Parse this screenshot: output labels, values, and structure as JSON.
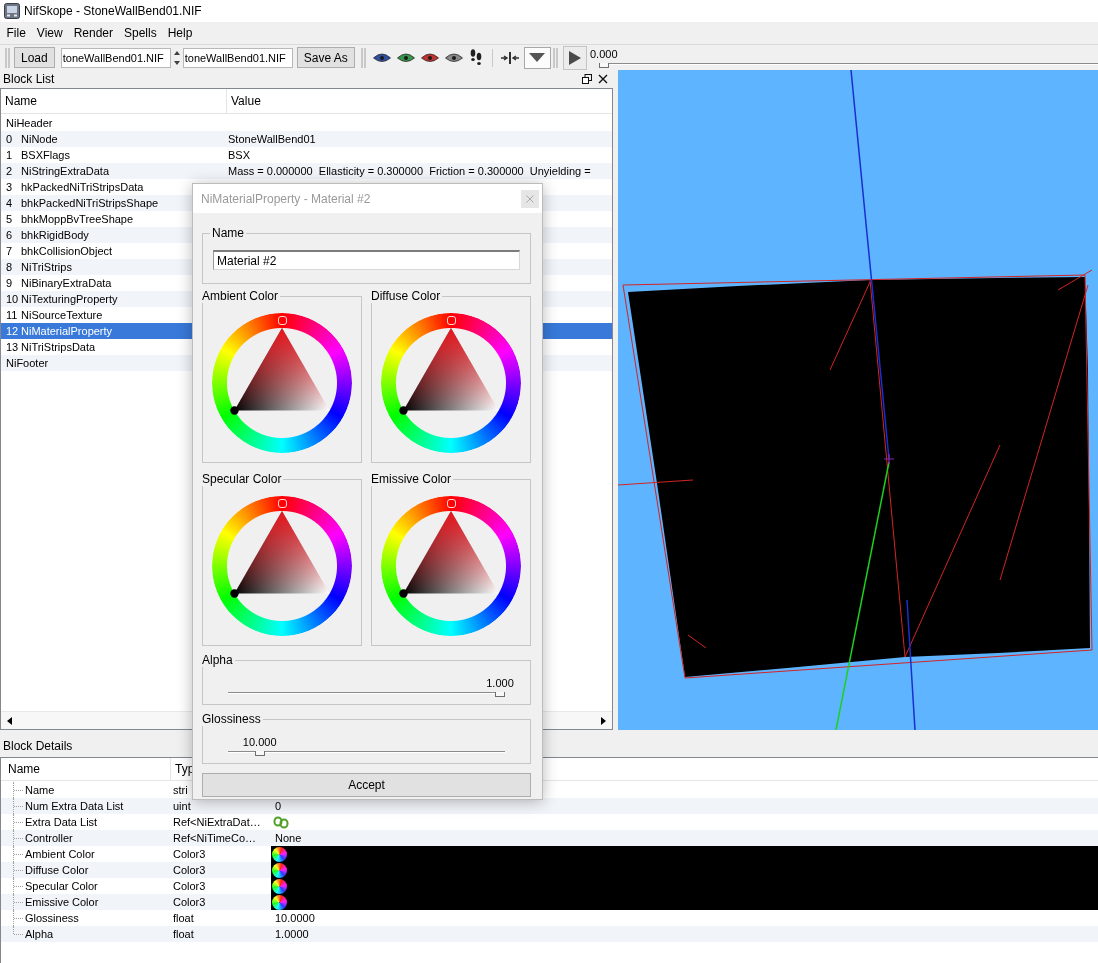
{
  "window": {
    "title": "NifSkope - StoneWallBend01.NIF"
  },
  "menu": [
    "File",
    "View",
    "Render",
    "Spells",
    "Help"
  ],
  "toolbar": {
    "load_button": "Load",
    "file_fields": [
      "toneWallBend01.NIF",
      "toneWallBend01.NIF"
    ],
    "save_button": "Save As",
    "view_buttons": [
      {
        "color": "#2f4fa3"
      },
      {
        "color": "#35984a"
      },
      {
        "color": "#c23232"
      },
      {
        "color": "#8a8a8a"
      }
    ],
    "dropdown_button": {
      "checked": true
    },
    "time_slider": {
      "reading": "0.000",
      "level": 0
    }
  },
  "block_list": {
    "title": "Block List",
    "columns": [
      "Name",
      "Value"
    ],
    "rows": [
      {
        "name": "NiHeader",
        "selected": false
      },
      {
        "index": "0",
        "name": "NiNode",
        "value": "StoneWallBend01",
        "selected": false
      },
      {
        "index": "1",
        "name": "BSXFlags",
        "value": "BSX",
        "selected": false
      },
      {
        "index": "2",
        "name": "NiStringExtraData",
        "value": "Mass = 0.000000  Ellasticity = 0.300000  Friction = 0.300000  Unyielding =",
        "selected": false
      },
      {
        "index": "3",
        "name": "hkPackedNiTriStripsData",
        "selected": false
      },
      {
        "index": "4",
        "name": "bhkPackedNiTriStripsShape",
        "selected": false
      },
      {
        "index": "5",
        "name": "bhkMoppBvTreeShape",
        "selected": false
      },
      {
        "index": "6",
        "name": "bhkRigidBody",
        "selected": false
      },
      {
        "index": "7",
        "name": "bhkCollisionObject",
        "selected": false
      },
      {
        "index": "8",
        "name": "NiTriStrips",
        "selected": false
      },
      {
        "index": "9",
        "name": "NiBinaryExtraData",
        "selected": false
      },
      {
        "index": "10",
        "name": "NiTexturingProperty",
        "selected": false
      },
      {
        "index": "11",
        "name": "NiSourceTexture",
        "selected": false
      },
      {
        "index": "12",
        "name": "NiMaterialProperty",
        "selected": true
      },
      {
        "index": "13",
        "name": "NiTriStripsData",
        "selected": false
      },
      {
        "name": "NiFooter",
        "selected": false
      }
    ]
  },
  "block_details": {
    "title": "Block Details",
    "columns": [
      "Name",
      "Typ"
    ],
    "rows": [
      {
        "name": "Name",
        "type": "stri",
        "kind": "text",
        "selected": false
      },
      {
        "name": "Num Extra Data List",
        "type": "uint",
        "kind": "text",
        "value": "0",
        "selected": false
      },
      {
        "name": "Extra Data List",
        "type": "Ref<NiExtraDat…",
        "kind": "link",
        "selected": false
      },
      {
        "name": "Controller",
        "type": "Ref<NiTimeCo…",
        "kind": "text",
        "value": "None",
        "selected": false
      },
      {
        "name": "Ambient Color",
        "type": "Color3",
        "kind": "color",
        "color": "#000000",
        "selected": false
      },
      {
        "name": "Diffuse Color",
        "type": "Color3",
        "kind": "color",
        "color": "#000000",
        "selected": false
      },
      {
        "name": "Specular Color",
        "type": "Color3",
        "kind": "color",
        "color": "#000000",
        "selected": false
      },
      {
        "name": "Emissive Color",
        "type": "Color3",
        "kind": "color",
        "color": "#000000",
        "selected": false
      },
      {
        "name": "Glossiness",
        "type": "float",
        "kind": "text",
        "value": "10.0000",
        "selected": false
      },
      {
        "name": "Alpha",
        "type": "float",
        "kind": "text",
        "value": "1.0000",
        "selected": false
      }
    ]
  },
  "dialog": {
    "title": "NiMaterialProperty - Material #2",
    "name_group": {
      "label": "Name",
      "value": "Material #2"
    },
    "color_groups": [
      {
        "label": "Ambient Color",
        "color": "#000000"
      },
      {
        "label": "Diffuse Color",
        "color": "#000000"
      },
      {
        "label": "Specular Color",
        "color": "#000000"
      },
      {
        "label": "Emissive Color",
        "color": "#000000"
      }
    ],
    "sliders": [
      {
        "label": "Alpha",
        "reading": "1.000",
        "level": 1
      },
      {
        "label": "Glossiness",
        "reading": "10.000",
        "level": 0.1
      }
    ],
    "accept_button": "Accept"
  }
}
